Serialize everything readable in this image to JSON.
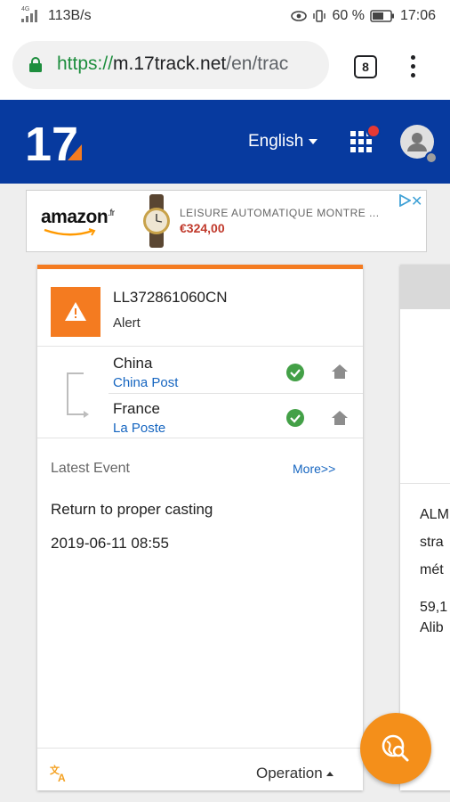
{
  "status_bar": {
    "network_type": "4G",
    "speed": "113B/s",
    "battery_percent": "60 %",
    "time": "17:06"
  },
  "browser": {
    "url_scheme": "https://",
    "url_host": "m.17track.net",
    "url_path": "/en/trac",
    "tab_count": "8"
  },
  "header": {
    "logo_text": "17",
    "language": "English"
  },
  "ad": {
    "brand": "amazon",
    "brand_suffix": ".fr",
    "description": "LEISURE AUTOMATIQUE MONTRE ...",
    "price": "€324,00"
  },
  "tracking": {
    "number": "LL372861060CN",
    "status": "Alert",
    "origin": {
      "country": "China",
      "carrier": "China Post"
    },
    "destination": {
      "country": "France",
      "carrier": "La Poste"
    },
    "latest_event_label": "Latest Event",
    "more_link": "More>>",
    "event_description": "Return to proper casting",
    "event_time": "2019-06-11 08:55",
    "operation_label": "Operation"
  },
  "second_card": {
    "line1": "ALM",
    "line2": "stra",
    "line3": "mét",
    "line4": "59,1",
    "line5": "Alib"
  },
  "colors": {
    "brand_blue": "#073a9f",
    "accent_orange": "#f47b20",
    "link_blue": "#1565c0",
    "check_green": "#43a047"
  }
}
